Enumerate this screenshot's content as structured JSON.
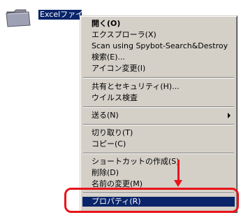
{
  "desktop": {
    "folder_icon": "folder-icon",
    "folder_label": "Excelファイル"
  },
  "menu": {
    "items": [
      {
        "label": "開く(O)",
        "bold": true
      },
      {
        "label": "エクスプローラ(X)"
      },
      {
        "label": "Scan using Spybot-Search&Destroy"
      },
      {
        "label": "検索(E)..."
      },
      {
        "label": "アイコン変更(I)"
      },
      {
        "label": "共有とセキュリティ(H)..."
      },
      {
        "label": "ウイルス検査"
      },
      {
        "label": "送る(N)",
        "submenu": true
      },
      {
        "label": "切り取り(T)"
      },
      {
        "label": "コピー(C)"
      },
      {
        "label": "ショートカットの作成(S)"
      },
      {
        "label": "削除(D)"
      },
      {
        "label": "名前の変更(M)"
      },
      {
        "label": "プロパティ(R)",
        "selected": true
      }
    ]
  },
  "annotation": {
    "color": "#e8141b",
    "arrow": "down-arrow",
    "target": "プロパティ(R)"
  },
  "colors": {
    "menu_bg": "#d4d0c8",
    "selection": "#0a246a"
  }
}
